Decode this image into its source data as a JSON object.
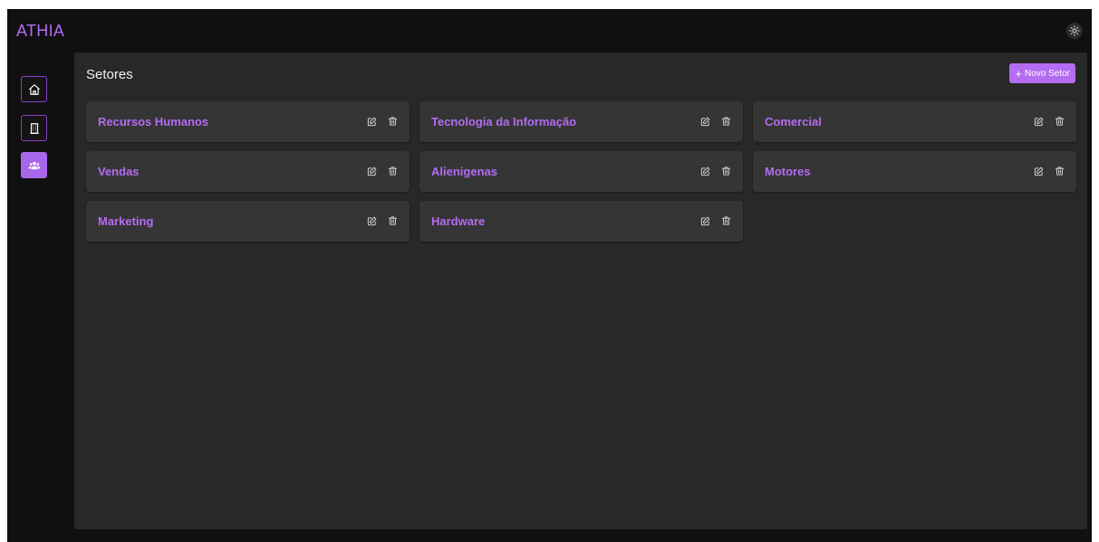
{
  "app": {
    "brand": "ATHIA"
  },
  "sidebar": {
    "items": [
      {
        "icon": "home-icon",
        "active": false
      },
      {
        "icon": "building-icon",
        "active": false
      },
      {
        "icon": "users-icon",
        "active": true
      }
    ]
  },
  "page": {
    "title": "Setores",
    "new_button_label": "Novo Setor"
  },
  "sectors": [
    "Recursos Humanos",
    "Tecnologia da Informação",
    "Comercial",
    "Vendas",
    "Alienigenas",
    "Motores",
    "Marketing",
    "Hardware"
  ],
  "colors": {
    "accent": "#b46cf2",
    "background": "#101010",
    "panel": "#282828",
    "card": "#353535"
  }
}
